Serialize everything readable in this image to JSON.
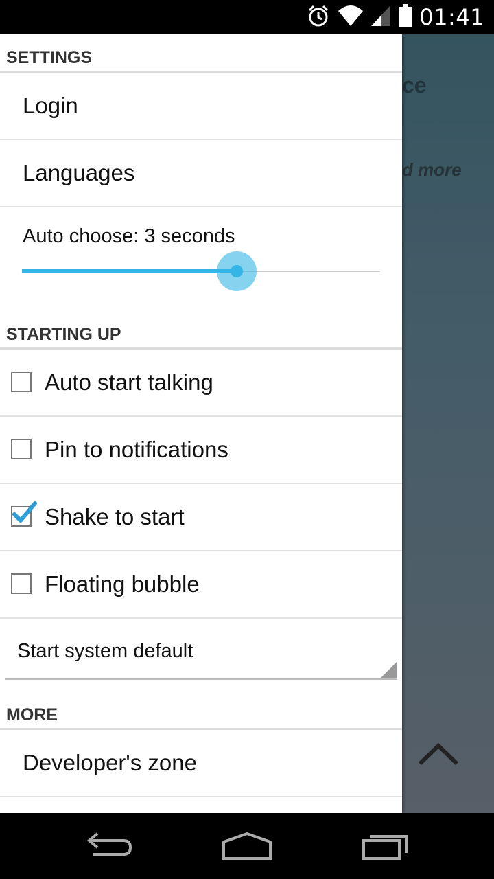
{
  "status_bar": {
    "time": "01:41",
    "icons": [
      "alarm-icon",
      "wifi-icon",
      "signal-icon",
      "battery-icon"
    ]
  },
  "background_app": {
    "title_fragment": "ce",
    "more_fragment": "d more"
  },
  "drawer": {
    "settings_header": "SETTINGS",
    "login_label": "Login",
    "languages_label": "Languages",
    "auto_choose_label": "Auto choose: 3 seconds",
    "auto_choose_fraction": 0.6,
    "starting_up_header": "STARTING UP",
    "options": [
      {
        "label": "Auto start talking",
        "checked": false
      },
      {
        "label": "Pin to notifications",
        "checked": false
      },
      {
        "label": "Shake to start",
        "checked": true
      },
      {
        "label": "Floating bubble",
        "checked": false
      }
    ],
    "start_system_selected": "Start system default",
    "more_header": "MORE",
    "developers_zone_label": "Developer's zone"
  },
  "colors": {
    "accent": "#33b5e5",
    "drawer_bg": "#ffffff",
    "background_app": "#445c68"
  }
}
